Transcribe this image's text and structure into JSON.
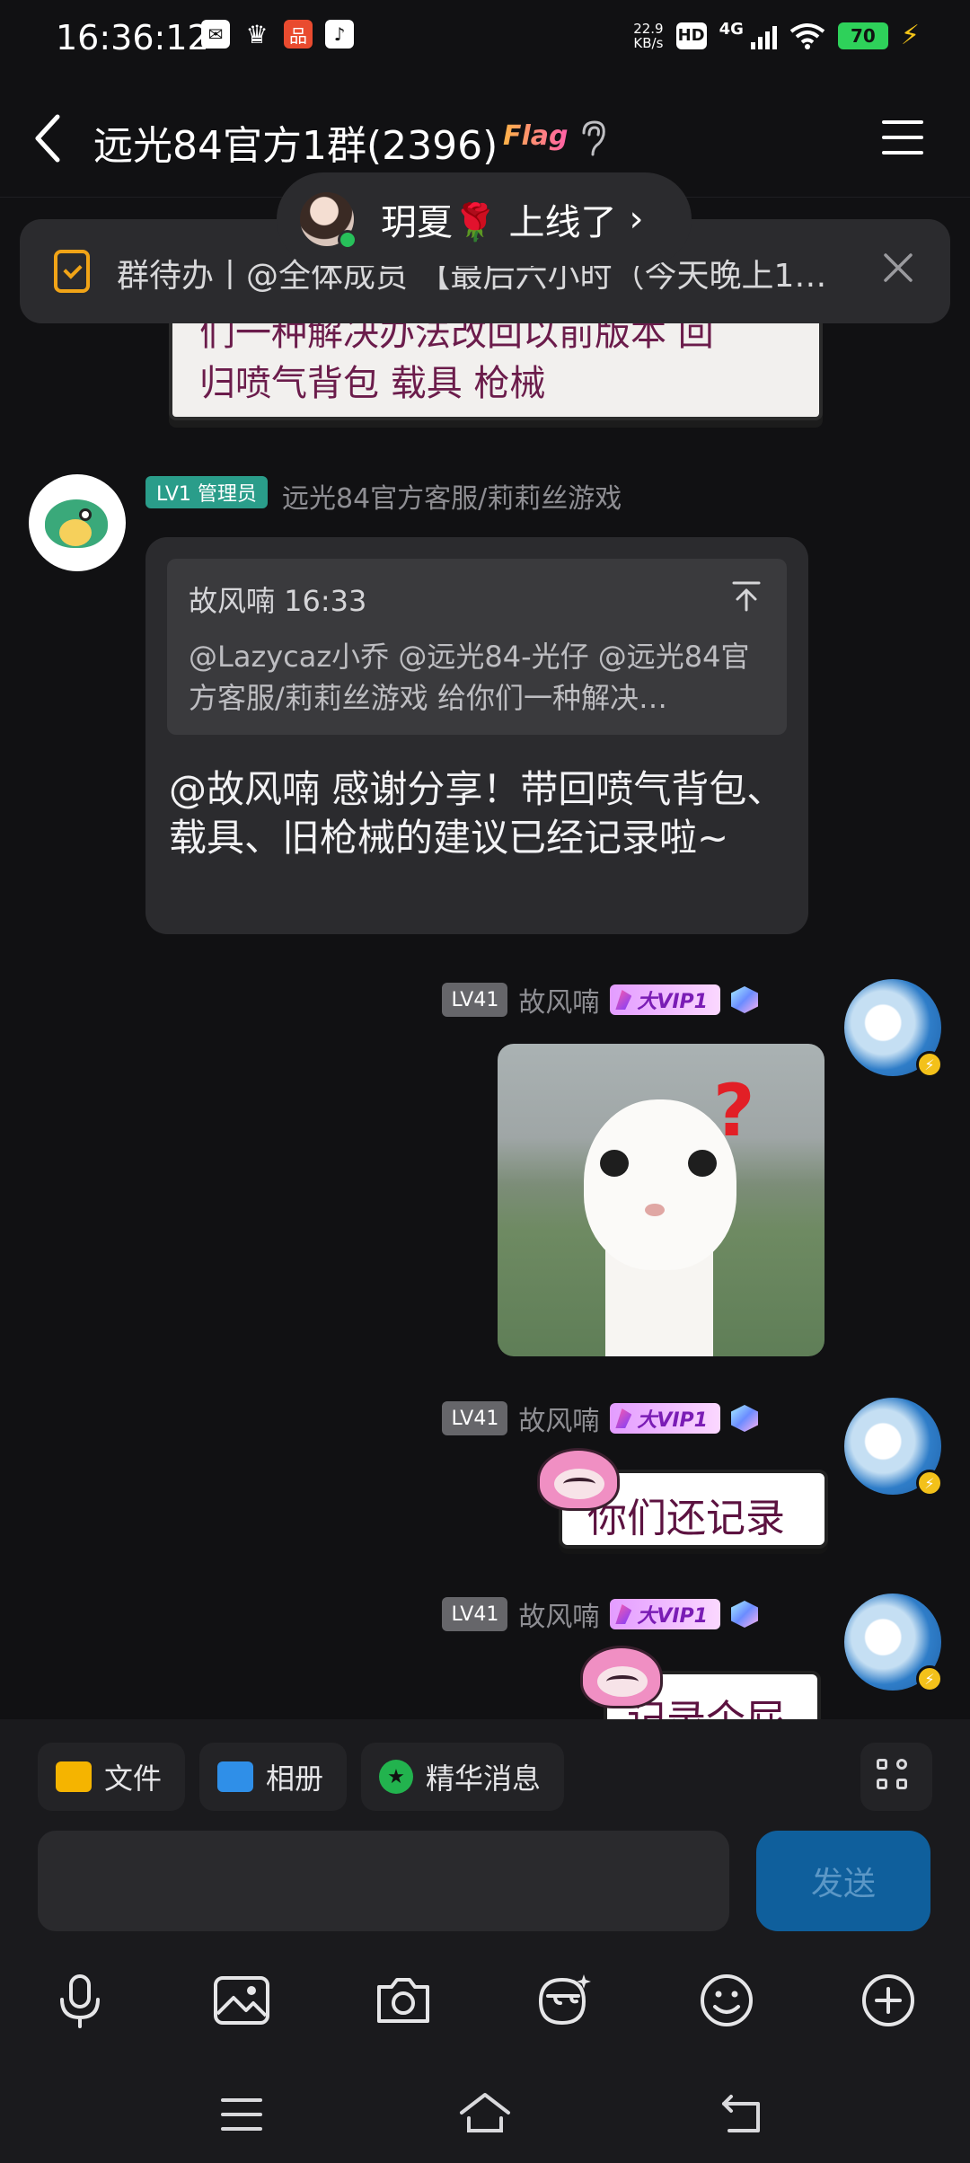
{
  "status_bar": {
    "time": "16:36:12",
    "net_speed_value": "22.9",
    "net_speed_unit": "KB/s",
    "hd_label": "HD",
    "network": "4G",
    "battery": "70"
  },
  "header": {
    "title": "远光84官方1群(2396)",
    "flag_badge": "Flag"
  },
  "online_toast": {
    "text": "玥夏🌹 上线了"
  },
  "todo_banner": {
    "text": "群待办丨@全体成员 【最后六小时（今天晚上1…"
  },
  "top_sticker": {
    "line1": "们一种解决办法改回以前版本 回",
    "line2": "归喷气背包 载具 枪械"
  },
  "incoming": {
    "level_badge": "LV1 管理员",
    "sender": "远光84官方客服/莉莉丝游戏",
    "quote_header": "故风喃 16:33",
    "quote_body": "@Lazycaz小乔 @远光84-光仔 @远光84官方客服/莉莉丝游戏 给你们一种解决…",
    "text": "@故风喃 感谢分享！带回喷气背包、载具、旧枪械的建议已经记录啦~"
  },
  "outgoing": [
    {
      "level": "LV41",
      "name": "故风喃",
      "vip": "大VIP1"
    },
    {
      "level": "LV41",
      "name": "故风喃",
      "vip": "大VIP1",
      "sticker_text": "你们还记录"
    },
    {
      "level": "LV41",
      "name": "故风喃",
      "vip": "大VIP1",
      "sticker_text": "记录个屁"
    }
  ],
  "quick_chips": [
    {
      "label": "文件",
      "icon": "folder-icon",
      "color": "#f5b400"
    },
    {
      "label": "相册",
      "icon": "photo-icon",
      "color": "#2f8fe8"
    },
    {
      "label": "精华消息",
      "icon": "star-badge-icon",
      "color": "#22b34e"
    }
  ],
  "composer": {
    "send_label": "发送"
  },
  "tools": [
    "mic-icon",
    "image-icon",
    "camera-icon",
    "sticker-face-icon",
    "emoji-icon",
    "plus-circle-icon"
  ],
  "nav": [
    "menu-icon",
    "home-icon",
    "back-icon"
  ]
}
